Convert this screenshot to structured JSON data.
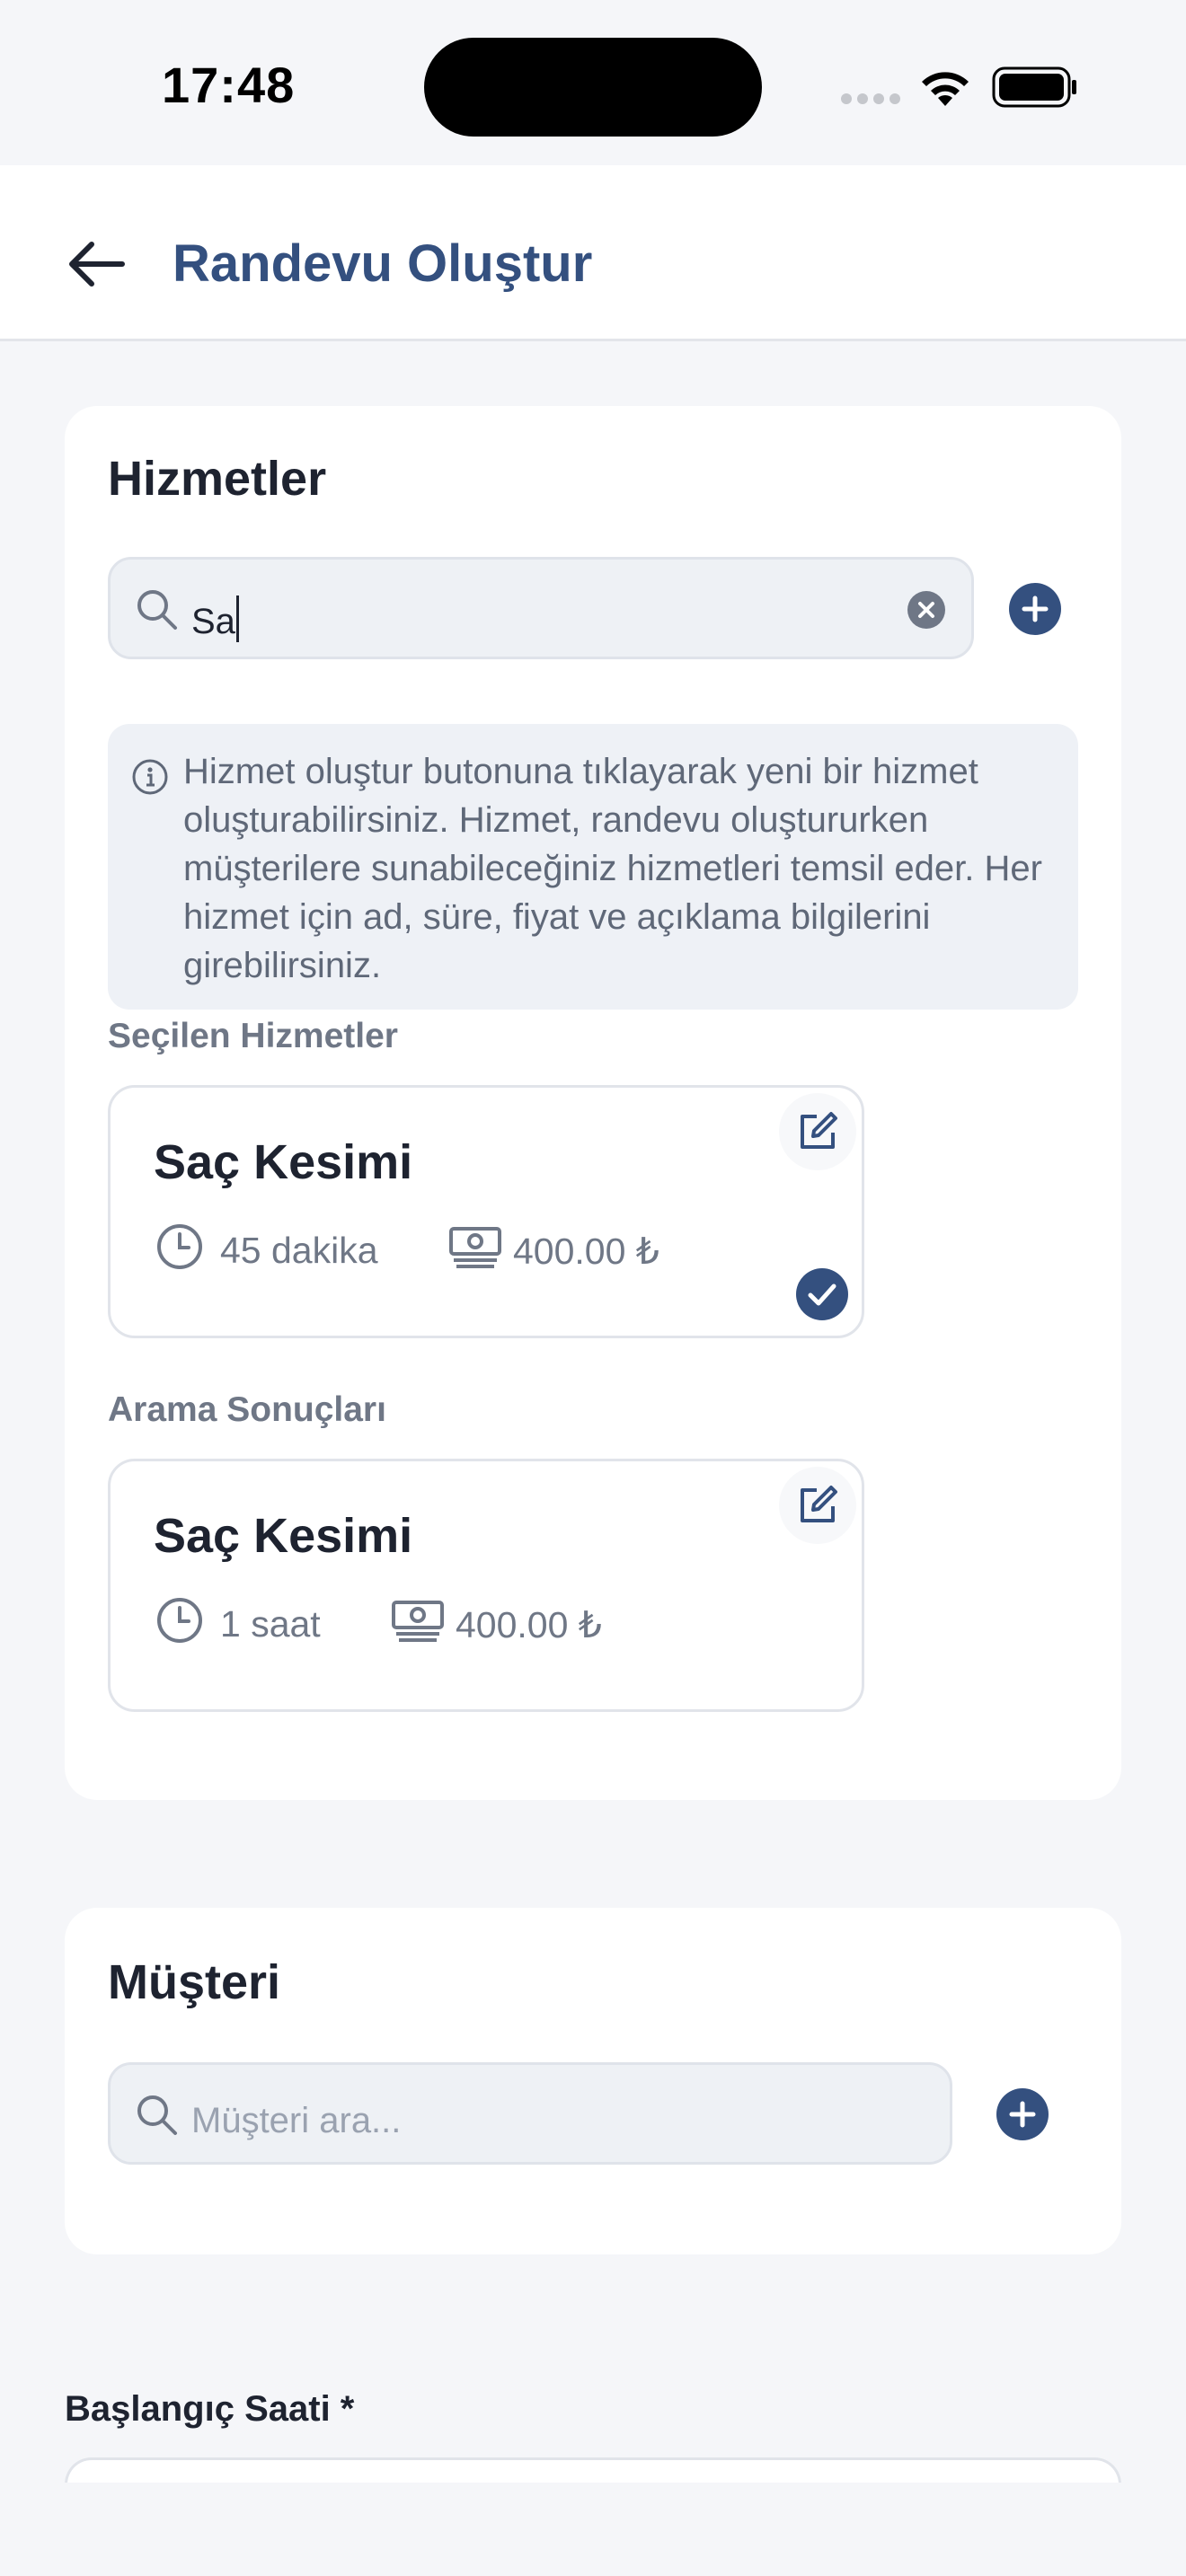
{
  "status_bar": {
    "time": "17:48"
  },
  "header": {
    "title": "Randevu Oluştur"
  },
  "services": {
    "title": "Hizmetler",
    "search_value": "Sa",
    "info_text": "Hizmet oluştur butonuna tıklayarak yeni bir hizmet oluşturabilirsiniz. Hizmet, randevu oluştururken müşterilere sunabileceğiniz hizmetleri temsil eder. Her hizmet için ad, süre, fiyat ve açıklama bilgilerini girebilirsiniz.",
    "selected_label": "Seçilen Hizmetler",
    "selected": [
      {
        "name": "Saç Kesimi",
        "duration": "45 dakika",
        "price": "400.00 ₺",
        "selected": true
      }
    ],
    "results_label": "Arama Sonuçları",
    "results": [
      {
        "name": "Saç Kesimi",
        "duration": "1 saat",
        "price": "400.00 ₺",
        "selected": false
      }
    ]
  },
  "customer": {
    "title": "Müşteri",
    "search_placeholder": "Müşteri ara..."
  },
  "start_time": {
    "label": "Başlangıç Saati *"
  },
  "colors": {
    "accent": "#34507f",
    "background": "#f5f6f9",
    "card": "#ffffff",
    "muted_text": "#6f7786"
  },
  "icons": [
    "back-arrow-icon",
    "search-icon",
    "clear-icon",
    "plus-icon",
    "info-icon",
    "edit-icon",
    "clock-icon",
    "money-icon",
    "check-icon"
  ]
}
